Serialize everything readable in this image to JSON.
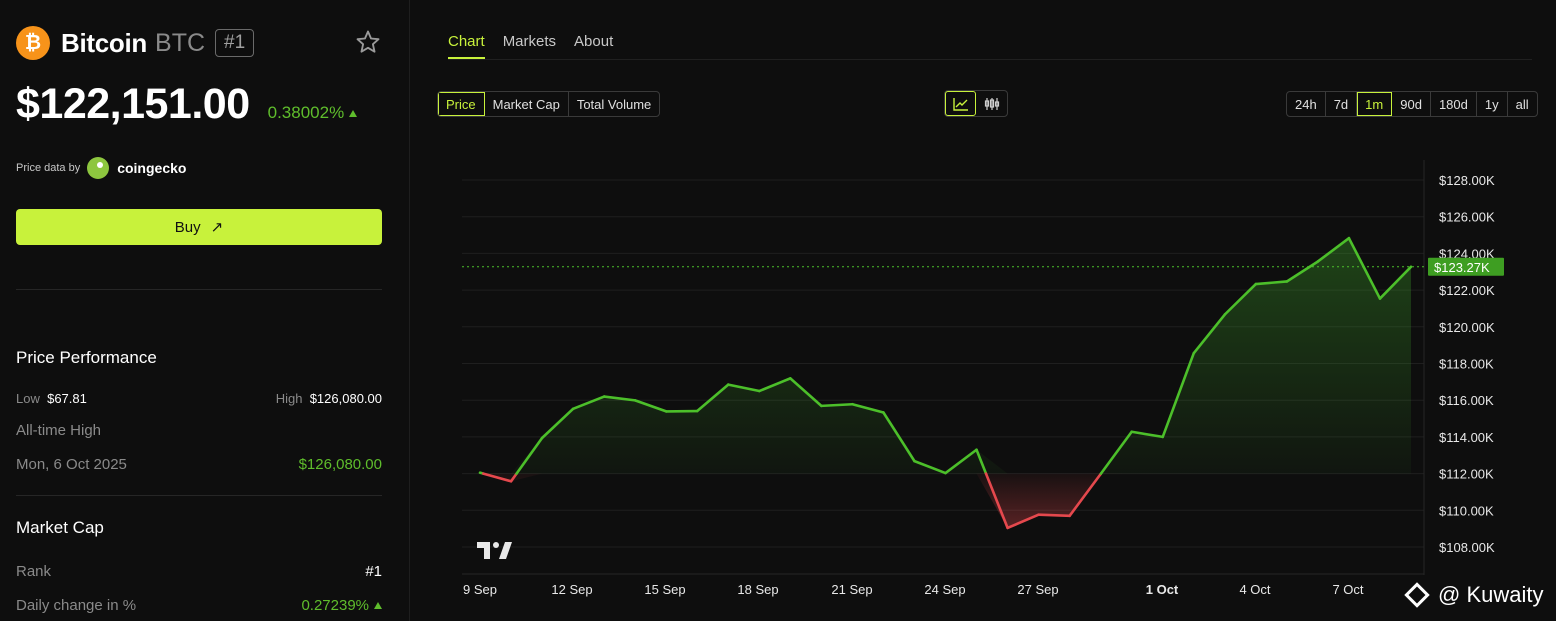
{
  "coin": {
    "name": "Bitcoin",
    "symbol": "BTC",
    "rank_badge": "#1",
    "logo_glyph": "₿"
  },
  "price": {
    "value": "$122,151.00",
    "change": "0.38002%"
  },
  "price_data": {
    "label": "Price data by",
    "provider": "coingecko"
  },
  "buy": {
    "label": "Buy",
    "arrow": "↗"
  },
  "performance": {
    "title": "Price Performance",
    "low_label": "Low",
    "low_value": "$67.81",
    "high_label": "High",
    "high_value": "$126,080.00",
    "ath_label": "All-time High",
    "ath_date": "Mon, 6 Oct 2025",
    "ath_value": "$126,080.00"
  },
  "market_cap": {
    "title": "Market Cap",
    "rank_label": "Rank",
    "rank_value": "#1",
    "daily_label": "Daily change in %",
    "daily_value": "0.27239%"
  },
  "tabs": [
    "Chart",
    "Markets",
    "About"
  ],
  "metric_tabs": [
    "Price",
    "Market Cap",
    "Total Volume"
  ],
  "ranges": [
    "24h",
    "7d",
    "1m",
    "90d",
    "180d",
    "1y",
    "all"
  ],
  "watermark": "@ Kuwaity",
  "colors": {
    "accent": "#c8f23b",
    "up": "#5fbd2c",
    "down": "#e5484d",
    "bg": "#0e0e0e"
  },
  "chart_data": {
    "type": "line",
    "x_ticks": [
      "9 Sep",
      "12 Sep",
      "15 Sep",
      "18 Sep",
      "21 Sep",
      "24 Sep",
      "27 Sep",
      "1 Oct",
      "4 Oct",
      "7 Oct"
    ],
    "y_ticks": [
      "$128.00K",
      "$126.00K",
      "$124.00K",
      "$122.00K",
      "$120.00K",
      "$118.00K",
      "$116.00K",
      "$114.00K",
      "$112.00K",
      "$110.00K",
      "$108.00K"
    ],
    "ylim": [
      107000,
      129000
    ],
    "baseline": 112000,
    "current_label": "$123.27K",
    "current_value": 123270,
    "values": [
      112050,
      111580,
      113940,
      115530,
      116200,
      115990,
      115390,
      115410,
      116850,
      116500,
      117190,
      115690,
      115780,
      115330,
      112680,
      112030,
      113300,
      109040,
      109760,
      109700,
      111980,
      114280,
      114000,
      118560,
      120670,
      122330,
      122470,
      123560,
      124830,
      121540,
      123270
    ]
  }
}
